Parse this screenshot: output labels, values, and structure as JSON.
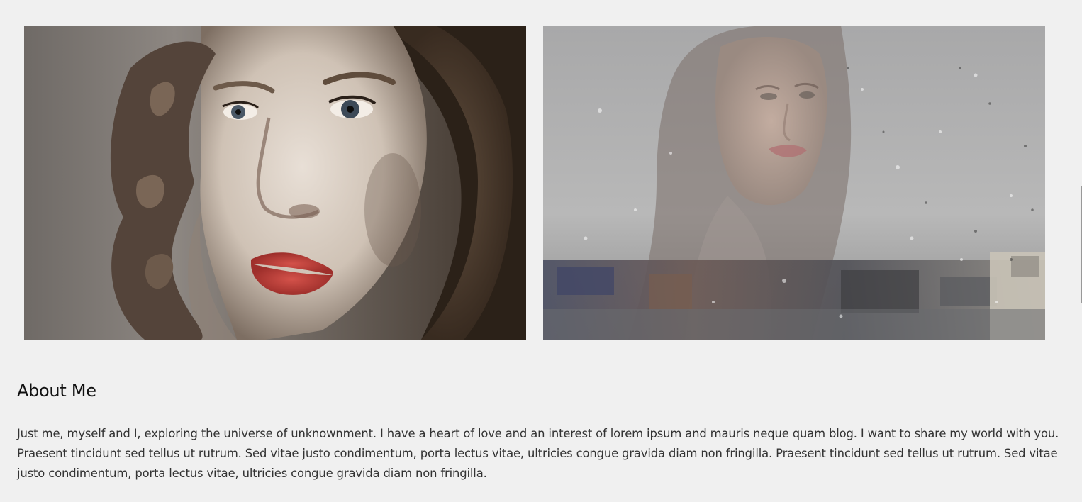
{
  "gallery": {
    "photos": [
      {
        "alt": "portrait-red-lips"
      },
      {
        "alt": "woman-behind-rainy-window"
      }
    ]
  },
  "about": {
    "title": "About Me",
    "body": "Just me, myself and I, exploring the universe of unknownment. I have a heart of love and an interest of lorem ipsum and mauris neque quam blog. I want to share my world with you. Praesent tincidunt sed tellus ut rutrum. Sed vitae justo condimentum, porta lectus vitae, ultricies congue gravida diam non fringilla. Praesent tincidunt sed tellus ut rutrum. Sed vitae justo condimentum, porta lectus vitae, ultricies congue gravida diam non fringilla."
  },
  "colors": {
    "background": "#f0f0f0",
    "heading": "#111111",
    "text": "#333333",
    "lips": "#c0403c"
  }
}
